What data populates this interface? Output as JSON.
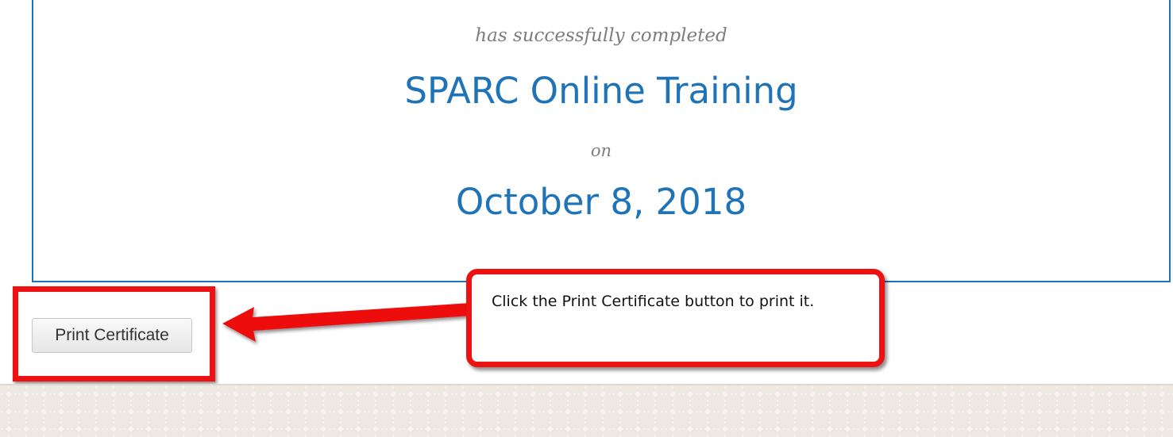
{
  "certificate": {
    "completed_text": "has successfully completed",
    "course_name": "SPARC Online Training",
    "on_text": "on",
    "date": "October 8, 2018"
  },
  "actions": {
    "print_label": "Print Certificate"
  },
  "annotation": {
    "callout_text": "Click the Print Certificate button to print it."
  },
  "colors": {
    "accent": "#1f73b7",
    "annotation_red": "#ee1111",
    "footer_bg": "#ede9e2"
  }
}
